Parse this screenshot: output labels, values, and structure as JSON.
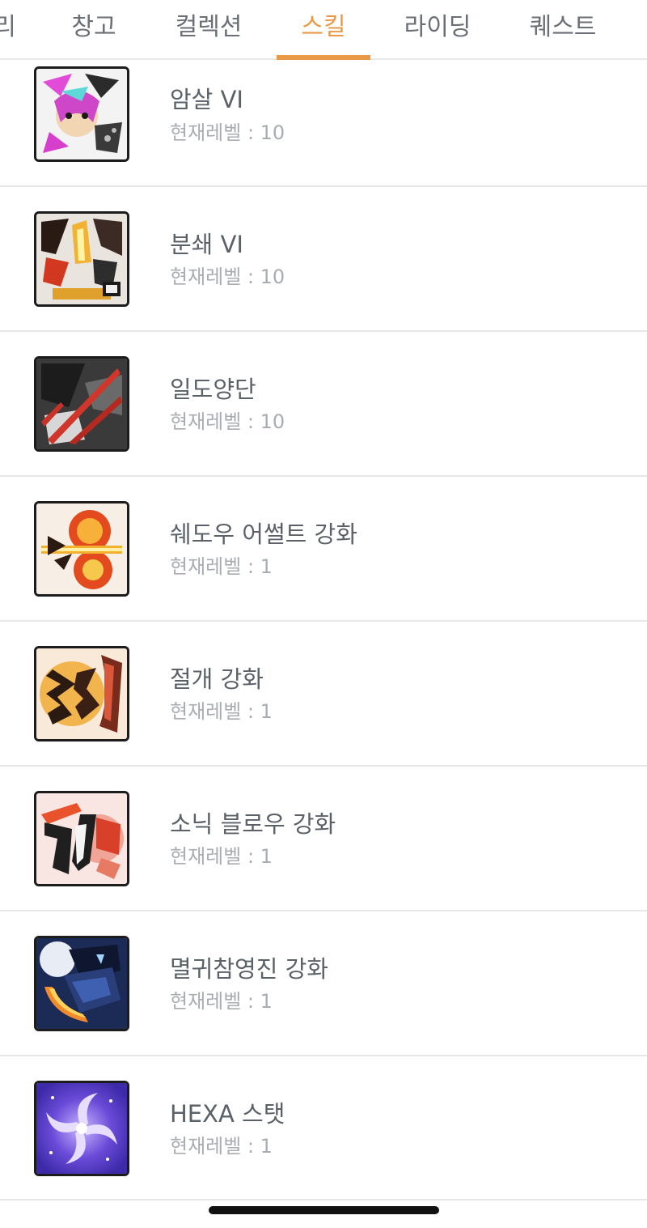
{
  "tabs": [
    {
      "label": "리",
      "active": false
    },
    {
      "label": "창고",
      "active": false
    },
    {
      "label": "컬렉션",
      "active": false
    },
    {
      "label": "스킬",
      "active": true
    },
    {
      "label": "라이딩",
      "active": false
    },
    {
      "label": "퀘스트",
      "active": false
    }
  ],
  "accent_color": "#ea9a47",
  "skills": [
    {
      "name": "암살 VI",
      "level": "현재레벨 : 10",
      "icon": "assassinate-skill-icon"
    },
    {
      "name": "분쇄 VI",
      "level": "현재레벨 : 10",
      "icon": "smash-skill-icon"
    },
    {
      "name": "일도양단",
      "level": "현재레벨 : 10",
      "icon": "cleave-skill-icon"
    },
    {
      "name": "쉐도우 어썰트 강화",
      "level": "현재레벨 : 1",
      "icon": "shadow-assault-skill-icon"
    },
    {
      "name": "절개 강화",
      "level": "현재레벨 : 1",
      "icon": "incision-skill-icon"
    },
    {
      "name": "소닉 블로우 강화",
      "level": "현재레벨 : 1",
      "icon": "sonic-blow-skill-icon"
    },
    {
      "name": "멸귀참영진 강화",
      "level": "현재레벨 : 1",
      "icon": "phantom-slash-skill-icon"
    },
    {
      "name": "HEXA 스탯",
      "level": "현재레벨 : 1",
      "icon": "hexa-stat-icon"
    }
  ]
}
